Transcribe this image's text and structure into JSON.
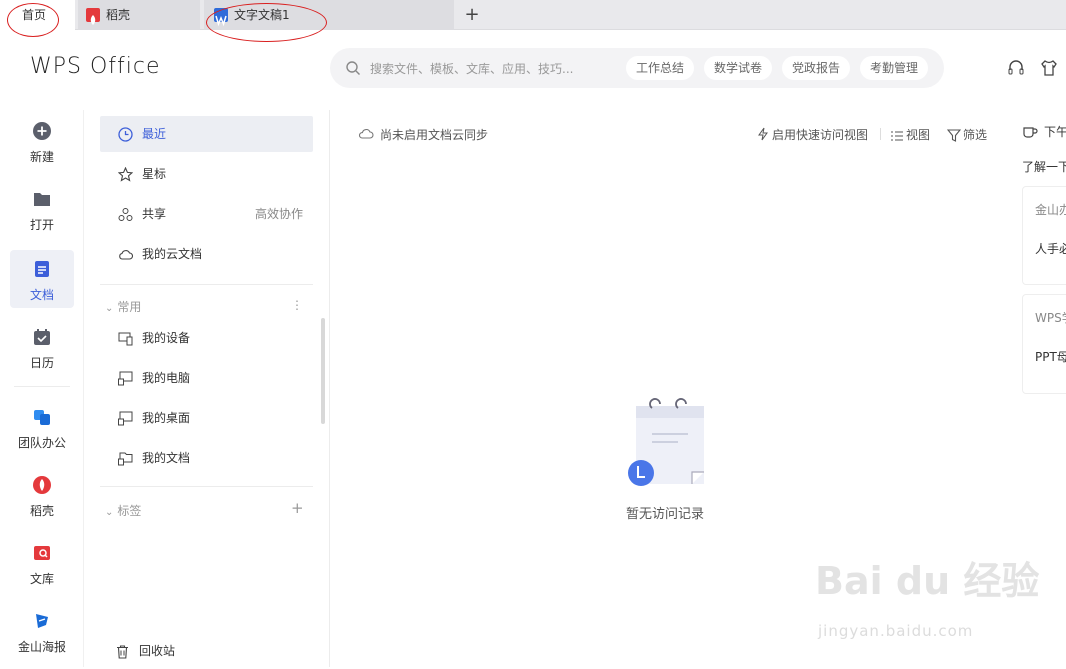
{
  "tabs": {
    "home": "首页",
    "daoke": "稻壳",
    "doc": "文字文稿1",
    "add": "+"
  },
  "header": {
    "logo": "WPS Office",
    "search_placeholder": "搜索文件、模板、文库、应用、技巧...",
    "chips": [
      "工作总结",
      "数学试卷",
      "党政报告",
      "考勤管理"
    ]
  },
  "rail": {
    "items": [
      {
        "label": "新建",
        "icon": "plus-circle-icon"
      },
      {
        "label": "打开",
        "icon": "folder-icon"
      },
      {
        "label": "文档",
        "icon": "document-icon"
      },
      {
        "label": "日历",
        "icon": "calendar-icon"
      },
      {
        "label": "团队办公",
        "icon": "team-icon"
      },
      {
        "label": "稻壳",
        "icon": "daoke-icon"
      },
      {
        "label": "文库",
        "icon": "library-icon"
      },
      {
        "label": "金山海报",
        "icon": "poster-icon"
      }
    ]
  },
  "nav": {
    "recent": "最近",
    "star": "星标",
    "share": "共享",
    "share_extra": "高效协作",
    "cloud": "我的云文档",
    "common_section": "常用",
    "device": "我的设备",
    "computer": "我的电脑",
    "desktop": "我的桌面",
    "documents": "我的文档",
    "tags_section": "标签",
    "recycle": "回收站"
  },
  "main": {
    "cloud_sync": "尚未启用文档云同步",
    "quick_access": "启用快速访问视图",
    "view": "视图",
    "filter": "筛选",
    "empty": "暂无访问记录"
  },
  "right_panel": {
    "greeting": "下午",
    "learn": "了解一下",
    "card1_title": "金山办",
    "card1_body": "人手必",
    "card2_title": "WPS学",
    "card2_body": "PPT母"
  },
  "watermark": {
    "main": "Bai du 经验",
    "url": "jingyan.baidu.com"
  },
  "colors": {
    "accent": "#3d5fd9",
    "annotation_red": "#d92020"
  }
}
